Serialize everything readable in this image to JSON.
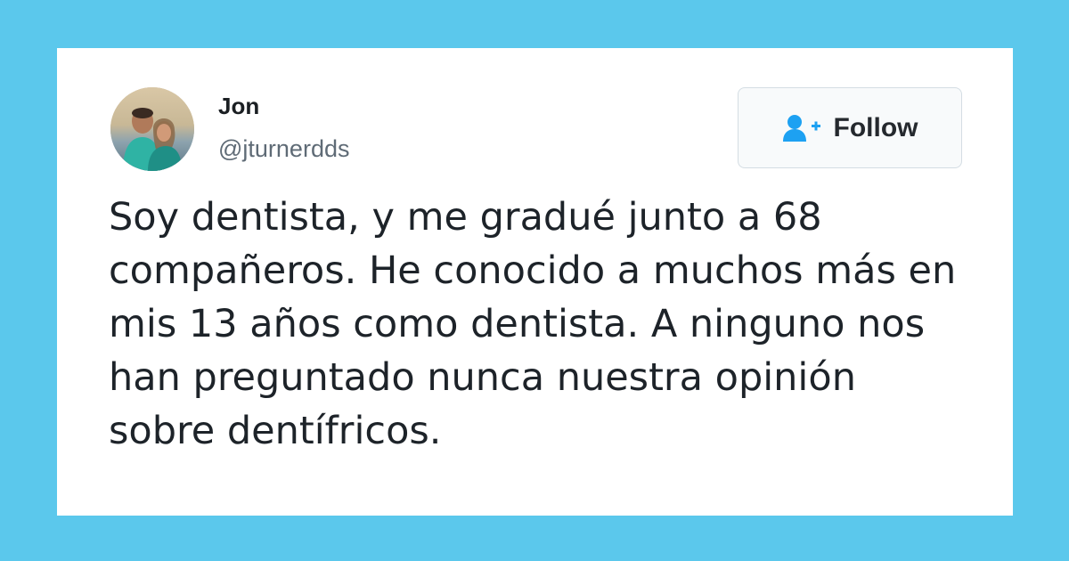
{
  "tweet": {
    "user": {
      "name": "Jon",
      "handle": "@jturnerdds",
      "avatar_icon": "profile-photo"
    },
    "follow_button": {
      "label": "Follow",
      "icon": "add-user-icon",
      "icon_color": "#1da1f2"
    },
    "text": "Soy dentista, y me gradué junto a 68 compañeros. He conocido a muchos más en mis 13 años como dentista. A ninguno nos han preguntado nunca nuestra opinión sobre dentífricos."
  },
  "colors": {
    "background": "#5bc8ec",
    "card": "#ffffff",
    "text": "#1d2329",
    "handle": "#5f6b76"
  }
}
